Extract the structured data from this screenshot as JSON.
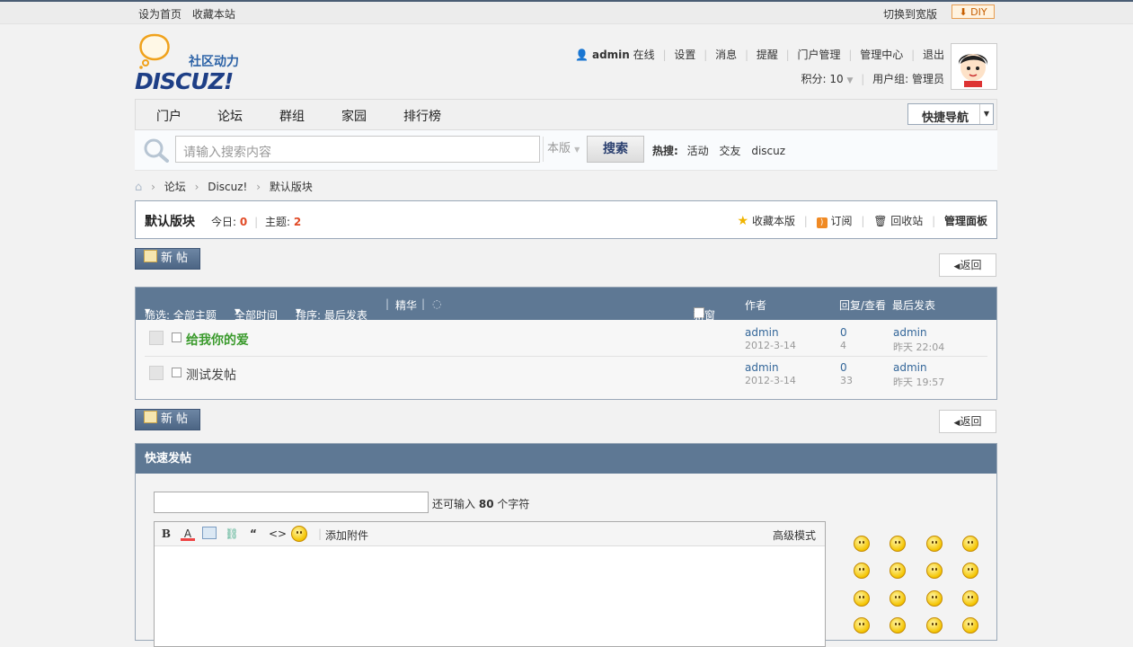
{
  "topbar": {
    "set_home": "设为首页",
    "bookmark": "收藏本站",
    "switch_width": "切换到宽版",
    "diy": "DIY"
  },
  "logo": {
    "wordmark": "DISCUZ!",
    "slogan": "社区动力"
  },
  "user": {
    "name": "admin",
    "online": "在线",
    "links": [
      "设置",
      "消息",
      "提醒",
      "门户管理",
      "管理中心",
      "退出"
    ],
    "points_label": "积分: 10",
    "group_label": "用户组: 管理员"
  },
  "nav": {
    "items": [
      "门户",
      "论坛",
      "群组",
      "家园",
      "排行榜"
    ],
    "quick_nav": "快捷导航"
  },
  "search": {
    "placeholder": "请输入搜索内容",
    "scope": "本版",
    "button": "搜索",
    "hot_label": "热搜:",
    "hot_terms": [
      "活动",
      "交友",
      "discuz"
    ]
  },
  "breadcrumb": [
    "论坛",
    "Discuz!",
    "默认版块"
  ],
  "forum": {
    "name": "默认版块",
    "today_label": "今日:",
    "today": "0",
    "topics_label": "主题:",
    "topics": "2",
    "actions": [
      "收藏本版",
      "订阅",
      "回收站",
      "管理面板"
    ]
  },
  "buttons": {
    "new_post": "新帖",
    "back": "返回"
  },
  "thread_header": {
    "filter": "筛选: 全部主题",
    "time": "全部时间",
    "sort": "排序: 最后发表",
    "digest": "精华",
    "new_window": "新窗",
    "author": "作者",
    "replies_views": "回复/查看",
    "last_post": "最后发表"
  },
  "threads": [
    {
      "title": "给我你的爱",
      "color": "#3a9a2c",
      "bold": true,
      "author": "admin",
      "date": "2012-3-14",
      "replies": "0",
      "views": "4",
      "last_user": "admin",
      "last_time": "昨天 22:04"
    },
    {
      "title": "测试发帖",
      "color": "#444444",
      "bold": false,
      "author": "admin",
      "date": "2012-3-14",
      "replies": "0",
      "views": "33",
      "last_user": "admin",
      "last_time": "昨天 19:57"
    }
  ],
  "quick_post": {
    "title": "快速发帖",
    "remain_prefix": "还可输入",
    "remain_count": "80",
    "remain_suffix": "个字符",
    "attach": "添加附件",
    "advanced": "高级模式",
    "toolbar": [
      "bold-icon",
      "font-color-icon",
      "image-icon",
      "link-icon",
      "quote-icon",
      "code-icon",
      "smiley-icon"
    ]
  },
  "colors": {
    "accent": "#5e7894",
    "border": "#9aa8b8",
    "highlight": "#e14b27"
  }
}
